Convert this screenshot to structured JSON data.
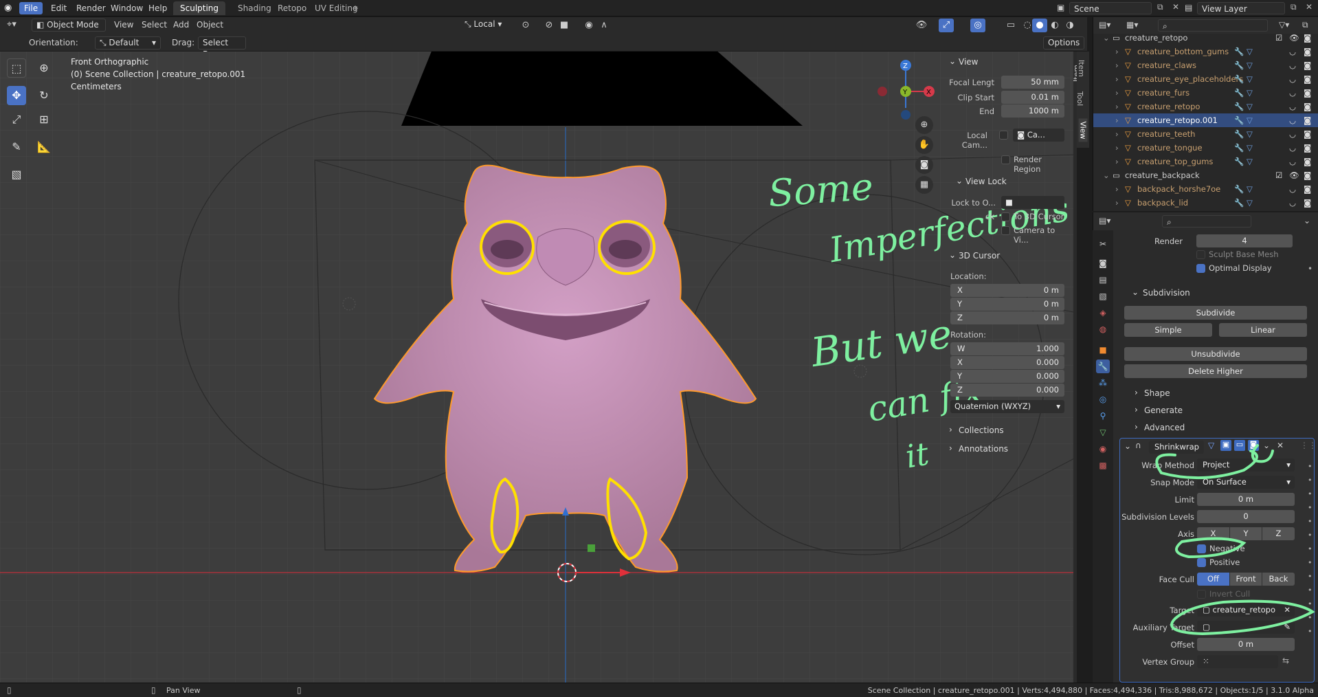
{
  "menubar": {
    "items": [
      "File",
      "Edit",
      "Render",
      "Window",
      "Help"
    ],
    "workspaces": [
      "Sculpting",
      "Shading",
      "Retopo",
      "UV Editing"
    ],
    "add_workspace": "+",
    "scene": "Scene",
    "view_layer": "View Layer"
  },
  "viewport_header": {
    "mode": "Object Mode",
    "menus": [
      "View",
      "Select",
      "Add",
      "Object"
    ],
    "transform_orientation": "Local",
    "orientation_label": "Orientation:",
    "orientation_value": "Default",
    "drag_label": "Drag:",
    "drag_value": "Select Box",
    "options": "Options"
  },
  "viewport_info": {
    "view": "Front Orthographic",
    "collection": "(0) Scene Collection | creature_retopo.001",
    "units": "Centimeters"
  },
  "gizmo": {
    "z": "Z",
    "y": "Y",
    "x": "X"
  },
  "side_tabs": [
    "Item",
    "Tool",
    "View"
  ],
  "npanel": {
    "view_title": "View",
    "focal_length_label": "Focal Lengt",
    "focal_length": "50 mm",
    "clip_start_label": "Clip Start",
    "clip_start": "0.01 m",
    "end_label": "End",
    "end": "1000 m",
    "local_camera_label": "Local Cam...",
    "local_camera_value": "Ca...",
    "render_region": "Render Region",
    "view_lock_title": "View Lock",
    "lock_to_object_label": "Lock to O...",
    "lock_label": "ck",
    "to_3d_cursor": "To 3D Cursor",
    "camera_to_view": "Camera to Vi...",
    "cursor_title": "3D Cursor",
    "location_label": "Location:",
    "loc": [
      {
        "axis": "X",
        "value": "0 m"
      },
      {
        "axis": "Y",
        "value": "0 m"
      },
      {
        "axis": "Z",
        "value": "0 m"
      }
    ],
    "rotation_label": "Rotation:",
    "rot": [
      {
        "axis": "W",
        "value": "1.000"
      },
      {
        "axis": "X",
        "value": "0.000"
      },
      {
        "axis": "Y",
        "value": "0.000"
      },
      {
        "axis": "Z",
        "value": "0.000"
      }
    ],
    "rotation_mode": "Quaternion (WXYZ)",
    "collections": "Collections",
    "annotations": "Annotations"
  },
  "outliner": {
    "rows": [
      {
        "name": "creature_retopo",
        "type": "collection",
        "indent": 0
      },
      {
        "name": "creature_bottom_gums",
        "type": "object",
        "indent": 1
      },
      {
        "name": "creature_claws",
        "type": "object",
        "indent": 1
      },
      {
        "name": "creature_eye_placeholders",
        "type": "object",
        "indent": 1
      },
      {
        "name": "creature_furs",
        "type": "object",
        "indent": 1
      },
      {
        "name": "creature_retopo",
        "type": "object",
        "indent": 1
      },
      {
        "name": "creature_retopo.001",
        "type": "object",
        "indent": 1,
        "selected": true
      },
      {
        "name": "creature_teeth",
        "type": "object",
        "indent": 1
      },
      {
        "name": "creature_tongue",
        "type": "object",
        "indent": 1
      },
      {
        "name": "creature_top_gums",
        "type": "object",
        "indent": 1
      },
      {
        "name": "creature_backpack",
        "type": "collection",
        "indent": 0
      },
      {
        "name": "backpack_horshe7oe",
        "type": "object",
        "indent": 1
      },
      {
        "name": "backpack_lid",
        "type": "object",
        "indent": 1
      }
    ]
  },
  "properties": {
    "render_label": "Render",
    "render_value": "4",
    "sculpt_base_mesh": "Sculpt Base Mesh",
    "optimal_display": "Optimal Display",
    "subdivision_title": "Subdivision",
    "subdivide": "Subdivide",
    "simple": "Simple",
    "linear": "Linear",
    "unsubdivide": "Unsubdivide",
    "delete_higher": "Delete Higher",
    "shape": "Shape",
    "generate": "Generate",
    "advanced": "Advanced",
    "modifier_name": "Shrinkwrap",
    "wrap_method_label": "Wrap Method",
    "wrap_method": "Project",
    "snap_mode_label": "Snap Mode",
    "snap_mode": "On Surface",
    "limit_label": "Limit",
    "limit": "0 m",
    "subdivision_levels_label": "Subdivision Levels",
    "subdivision_levels": "0",
    "axis_label": "Axis",
    "axes": [
      "X",
      "Y",
      "Z"
    ],
    "negative": "Negative",
    "positive": "Positive",
    "face_cull_label": "Face Cull",
    "face_cull": [
      "Off",
      "Front",
      "Back"
    ],
    "invert_cull": "Invert Cull",
    "target_label": "Target",
    "target": "creature_retopo",
    "auxiliary_target_label": "Auxiliary Target",
    "offset_label": "Offset",
    "offset": "0 m",
    "vertex_group_label": "Vertex Group"
  },
  "annotations": {
    "line1": "Some",
    "line2": "Imperfections",
    "line3": "But we",
    "line4": "can fix",
    "line5": "it"
  },
  "statusbar": {
    "pan_view": "Pan View",
    "info": "Scene Collection | creature_retopo.001 | Verts:4,494,880 | Faces:4,494,336 | Tris:8,988,672 | Objects:1/5 | 3.1.0 Alpha"
  },
  "colors": {
    "accent": "#4a72c4",
    "creature": "#c890b8",
    "outline": "#ff9a2a",
    "annotation_green": "#7ef0a0",
    "annotation_yellow": "#ffe000"
  }
}
